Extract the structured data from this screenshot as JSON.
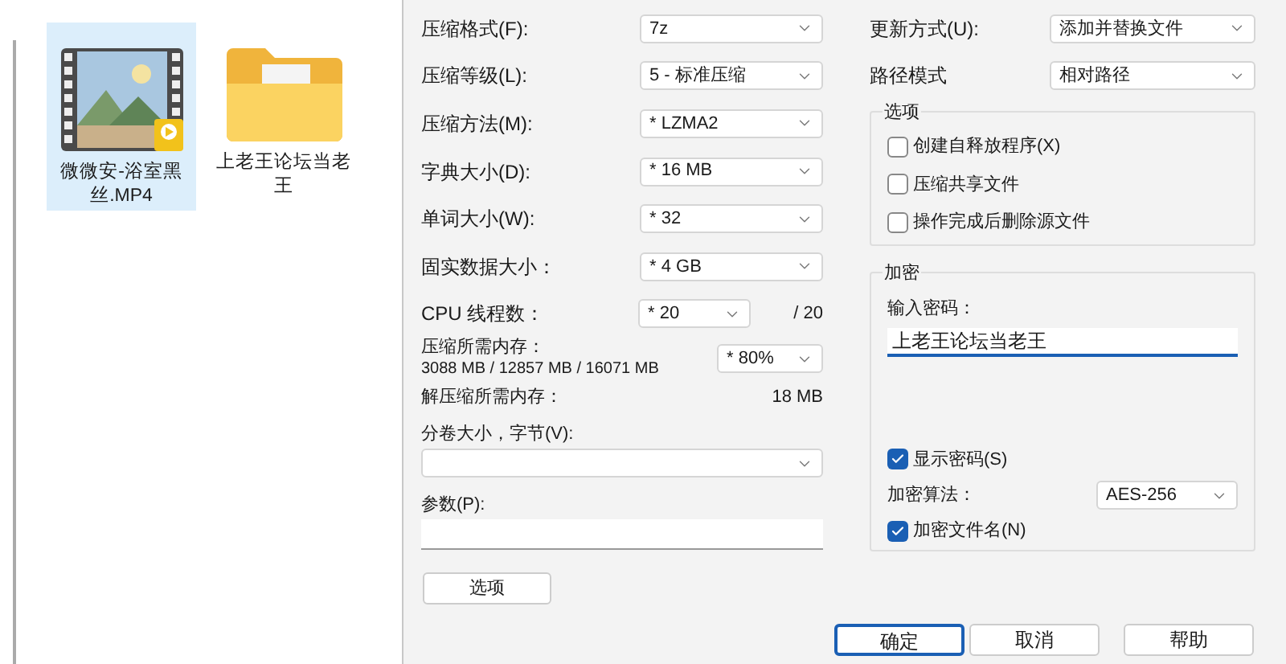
{
  "explorer": {
    "items": [
      {
        "name": "微微安-浴室黑丝.MP4",
        "kind": "video",
        "selected": true
      },
      {
        "name": "上老王论坛当老王",
        "kind": "folder",
        "selected": false
      }
    ]
  },
  "dialog": {
    "settings": [
      {
        "label": "压缩格式(F):",
        "value": "7z"
      },
      {
        "label": "压缩等级(L):",
        "value": "5 - 标准压缩"
      },
      {
        "label": "压缩方法(M):",
        "value": "*  LZMA2"
      },
      {
        "label": "字典大小(D):",
        "value": "*  16 MB"
      },
      {
        "label": "单词大小(W):",
        "value": "*  32"
      },
      {
        "label": "固实数据大小：",
        "value": "*  4 GB"
      }
    ],
    "threads": {
      "label": "CPU 线程数：",
      "value": "*  20",
      "max": "/ 20"
    },
    "memory": {
      "label": "压缩所需内存：",
      "detail": "3088 MB / 12857 MB / 16071 MB",
      "value": "*  80%"
    },
    "decompress_memory": {
      "label": "解压缩所需内存：",
      "value": "18 MB"
    },
    "volume": {
      "label": "分卷大小，字节(V):"
    },
    "parameters": {
      "label": "参数(P):"
    },
    "options_button": "选项",
    "update_mode": {
      "label": "更新方式(U):",
      "value": "添加并替换文件"
    },
    "path_mode": {
      "label": "路径模式",
      "value": "相对路径"
    },
    "options_group": {
      "title": "选项",
      "items": [
        {
          "label": "创建自释放程序(X)",
          "checked": false
        },
        {
          "label": "压缩共享文件",
          "checked": false
        },
        {
          "label": "操作完成后删除源文件",
          "checked": false
        }
      ]
    },
    "encryption": {
      "title": "加密",
      "password_label": "输入密码：",
      "password": "上老王论坛当老王",
      "show_password": {
        "label": "显示密码(S)",
        "checked": true
      },
      "method": {
        "label": "加密算法：",
        "value": "AES-256"
      },
      "encrypt_names": {
        "label": "加密文件名(N)",
        "checked": true
      }
    },
    "buttons": [
      {
        "label": "确定",
        "default": true
      },
      {
        "label": "取消",
        "default": false
      },
      {
        "label": "帮助",
        "default": false
      }
    ]
  }
}
